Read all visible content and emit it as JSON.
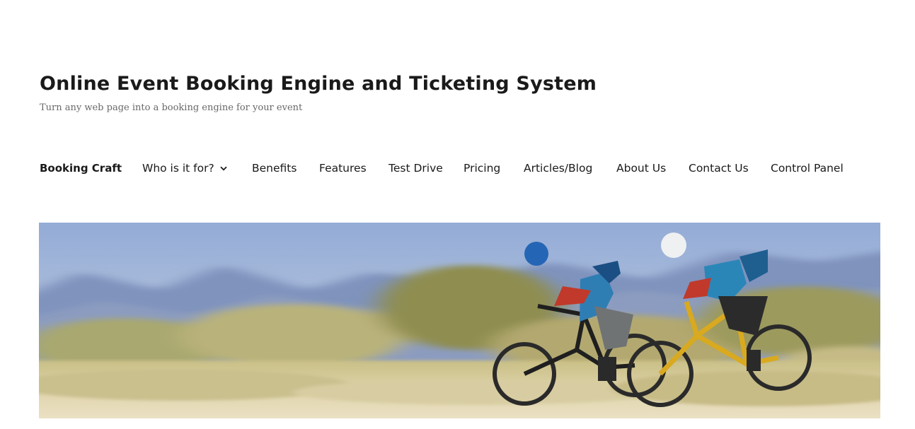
{
  "site": {
    "title": "Online Event Booking Engine and Ticketing System",
    "tagline": "Turn any web page into a booking engine for your event"
  },
  "nav": {
    "items": [
      {
        "label": "Booking Craft",
        "current": true
      },
      {
        "label": "Who is it for?",
        "has_submenu": true,
        "icon": "chevron-down-icon"
      },
      {
        "label": "Benefits"
      },
      {
        "label": "Features"
      },
      {
        "label": "Test Drive"
      },
      {
        "label": "Pricing"
      },
      {
        "label": "Articles/Blog"
      },
      {
        "label": "About Us"
      },
      {
        "label": "Contact Us"
      },
      {
        "label": "Control Panel"
      }
    ]
  },
  "hero": {
    "subject": "two mountain bikers riding on a blurred desert trail",
    "colors": {
      "sky": "#9fb4d8",
      "mountains": "#7d8fb5",
      "brush": "#b7ad6e",
      "ground": "#e8dcc0"
    }
  }
}
